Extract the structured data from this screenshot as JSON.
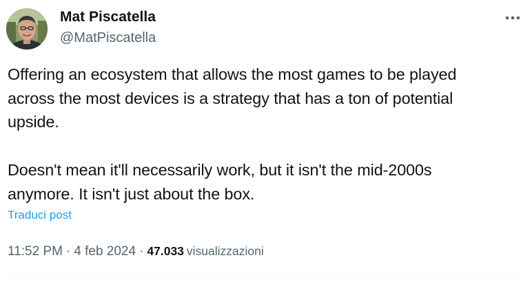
{
  "author": {
    "display_name": "Mat Piscatella",
    "handle": "@MatPiscatella",
    "avatar_icon": "profile-photo"
  },
  "tweet": {
    "text": "Offering an ecosystem that allows the most games to be played\nacross the most devices is a strategy that has a ton of potential\nupside.\n\nDoesn't mean it'll necessarily work, but it isn't the mid-2000s\nanymore. It isn't just about the box.",
    "translate_label": "Traduci post"
  },
  "meta": {
    "time": "11:52 PM",
    "separator": "·",
    "date": "4 feb 2024",
    "views_count": "47.033",
    "views_label": "visualizzazioni"
  },
  "more_icon": "more-horizontal-icon",
  "colors": {
    "text": "#0f1419",
    "secondary": "#536471",
    "link": "#1d9bf0",
    "divider": "#eff3f4"
  }
}
